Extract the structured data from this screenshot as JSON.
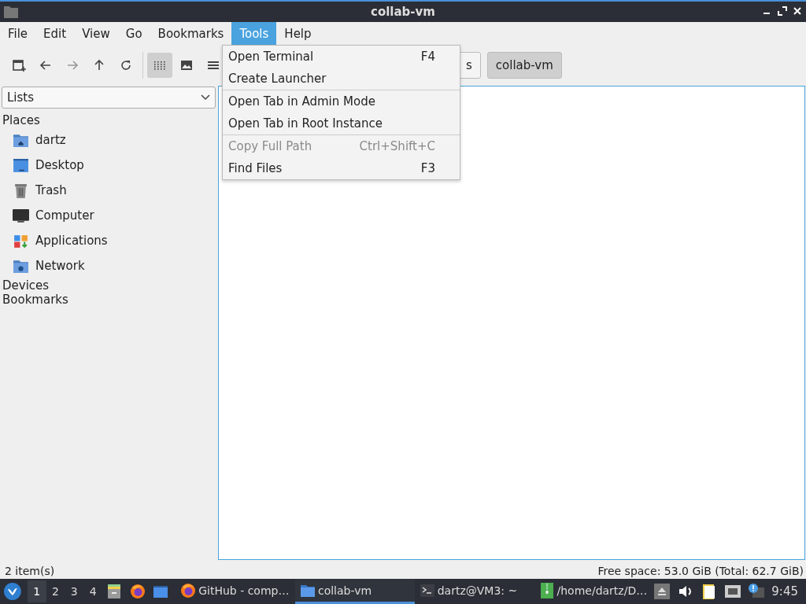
{
  "window": {
    "title": "collab-vm"
  },
  "menubar": [
    {
      "label": "File",
      "selected": false
    },
    {
      "label": "Edit",
      "selected": false
    },
    {
      "label": "View",
      "selected": false
    },
    {
      "label": "Go",
      "selected": false
    },
    {
      "label": "Bookmarks",
      "selected": false
    },
    {
      "label": "Tools",
      "selected": true
    },
    {
      "label": "Help",
      "selected": false
    }
  ],
  "toolbar": {
    "view_modes": [
      {
        "kind": "icons",
        "selected": true
      },
      {
        "kind": "thumbnails",
        "selected": false
      },
      {
        "kind": "list",
        "selected": false
      }
    ]
  },
  "path_bar": [
    {
      "label": "s",
      "selected": false
    },
    {
      "label": "collab-vm",
      "selected": true
    }
  ],
  "tools_menu": [
    {
      "label": "Open Terminal",
      "shortcut": "F4",
      "disabled": false,
      "separator_after": false
    },
    {
      "label": "Create Launcher",
      "disabled": false,
      "separator_after": true
    },
    {
      "label": "Open Tab in Admin Mode",
      "disabled": false,
      "separator_after": false
    },
    {
      "label": "Open Tab in Root Instance",
      "disabled": false,
      "separator_after": true
    },
    {
      "label": "Copy Full Path",
      "shortcut": "Ctrl+Shift+C",
      "disabled": true,
      "separator_after": false
    },
    {
      "label": "Find Files",
      "shortcut": "F3",
      "disabled": false,
      "separator_after": false
    }
  ],
  "sidebar": {
    "mode": "Lists",
    "sections": [
      {
        "title": "Places",
        "items": [
          {
            "label": "dartz",
            "kind": "home"
          },
          {
            "label": "Desktop",
            "kind": "desktop"
          },
          {
            "label": "Trash",
            "kind": "trash"
          },
          {
            "label": "Computer",
            "kind": "computer"
          },
          {
            "label": "Applications",
            "kind": "applications"
          },
          {
            "label": "Network",
            "kind": "network"
          }
        ]
      },
      {
        "title": "Devices"
      },
      {
        "title": "Bookmarks"
      }
    ]
  },
  "status_bar": {
    "items": "2 item(s)",
    "free_space": "Free space: 53.0 GiB (Total: 62.7 GiB)"
  },
  "taskbar": {
    "workspaces": [
      {
        "label": "1",
        "selected": true
      },
      {
        "label": "2",
        "selected": false
      },
      {
        "label": "3",
        "selected": false
      },
      {
        "label": "4",
        "selected": false
      }
    ],
    "launchers": [
      {
        "kind": "files"
      },
      {
        "kind": "firefox"
      },
      {
        "kind": "window"
      }
    ],
    "tasks": [
      {
        "label": "GitHub - comp…",
        "kind": "firefox",
        "selected": false
      },
      {
        "label": "collab-vm",
        "kind": "folder",
        "selected": true
      },
      {
        "label": "dartz@VM3: ~",
        "kind": "terminal",
        "selected": false
      },
      {
        "label": "/home/dartz/D…",
        "kind": "archive",
        "selected": false
      }
    ],
    "clock": "9:45"
  }
}
